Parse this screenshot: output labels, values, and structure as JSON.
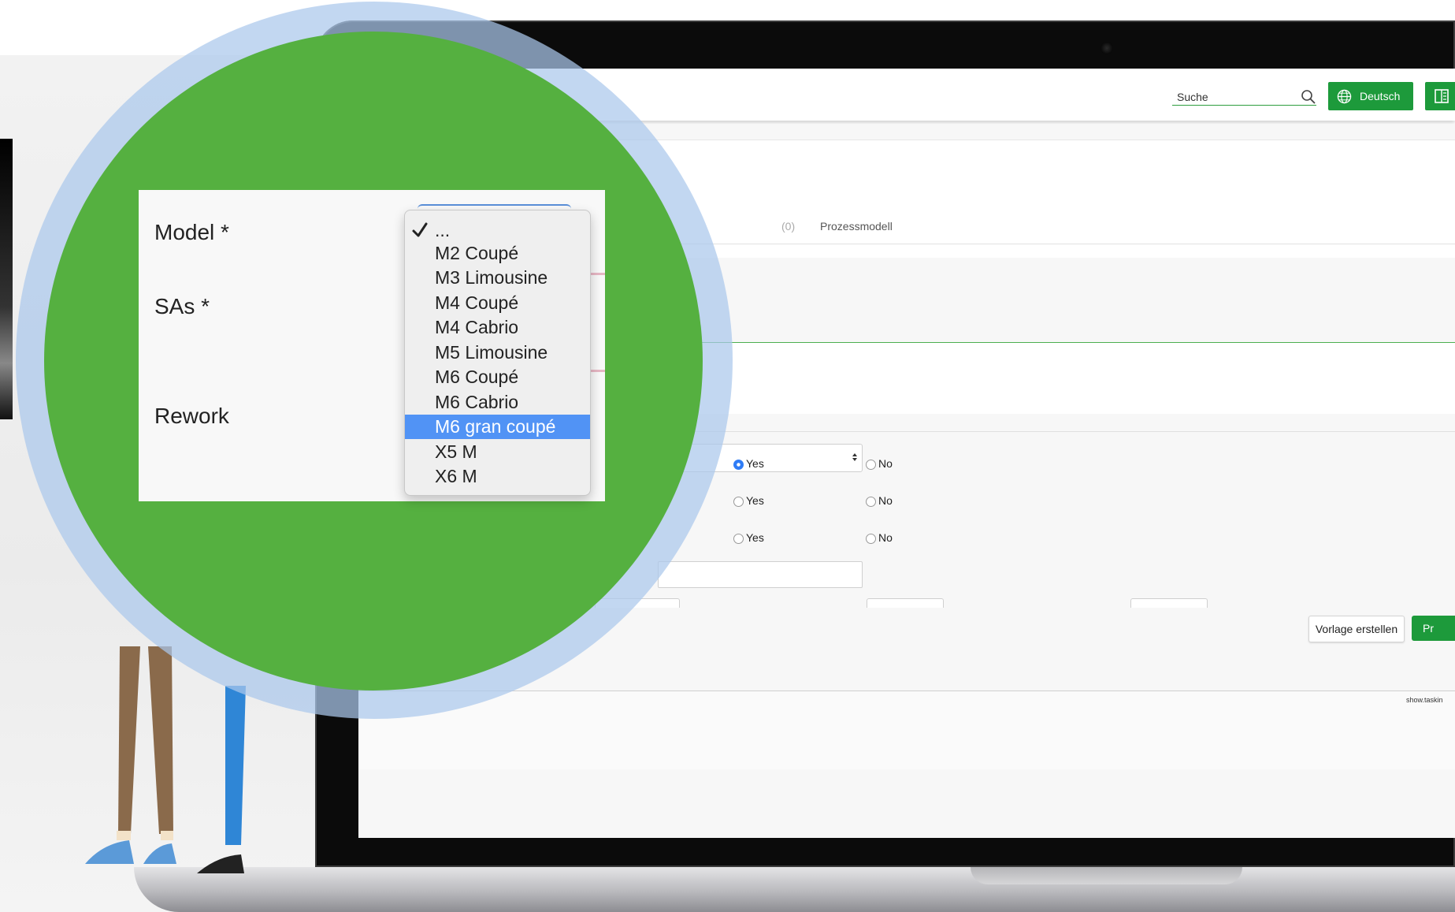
{
  "header": {
    "search_placeholder": "Suche",
    "language_label": "Deutsch"
  },
  "tabs": {
    "faded_label": "(0)",
    "process_label": "Prozessmodell"
  },
  "form": {
    "radio_rows": [
      {
        "yes_label": "Yes",
        "no_label": "No",
        "selected": "Yes"
      },
      {
        "yes_label": "Yes",
        "no_label": "No",
        "selected": null
      },
      {
        "yes_label": "Yes",
        "no_label": "No",
        "selected": null
      }
    ]
  },
  "actions": {
    "vorlage_label": "Vorlage erstellen",
    "primary_label": "Pr"
  },
  "footer": {
    "text": "show.taskin"
  },
  "magnifier": {
    "labels": {
      "model": "Model *",
      "sas": "SAs *",
      "rework": "Rework"
    },
    "dropdown": {
      "checked_item": "...",
      "selected_item": "M6 gran coupé",
      "options": [
        "...",
        "M2 Coupé",
        "M3 Limousine",
        "M4 Coupé",
        "M4 Cabrio",
        "M5 Limousine",
        "M6 Coupé",
        "M6 Cabrio",
        "M6 gran coupé",
        "X5 M",
        "X6 M"
      ]
    }
  },
  "colors": {
    "brand_green": "#1d9a3b",
    "lens_green": "#55b040",
    "selection_blue": "#5193f5",
    "radio_blue": "#2f7cf6"
  },
  "icons": {
    "search": "search-icon",
    "language": "globe-icon",
    "document": "document-icon",
    "check": "checkmark-icon"
  }
}
